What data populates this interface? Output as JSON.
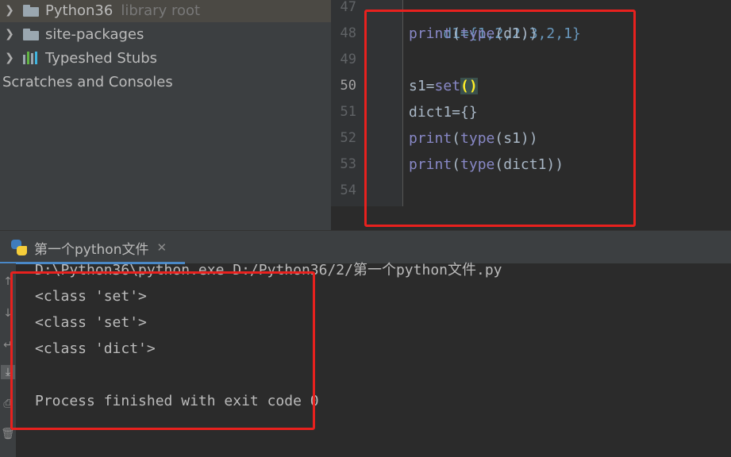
{
  "project_tree": {
    "items": [
      {
        "label": "Python36",
        "hint": "library root",
        "icon": "folder-icon"
      },
      {
        "label": "site-packages",
        "icon": "folder-icon"
      },
      {
        "label": "Typeshed Stubs",
        "icon": "stubs-icon"
      },
      {
        "label": "Scratches and Consoles"
      }
    ]
  },
  "editor": {
    "line_numbers": [
      "47",
      "48",
      "49",
      "50",
      "51",
      "52",
      "53",
      "54"
    ],
    "lines": {
      "l47": {
        "text": "d1={1,2,2,3,2,1}"
      },
      "l48": {
        "fn": "print",
        "open": "(",
        "inner_fn": "type",
        "arg": "(d1))"
      },
      "l50": {
        "lhs": "s1=",
        "fn": "set",
        "parens": "()"
      },
      "l51": {
        "text": "dict1={}"
      },
      "l52": {
        "fn": "print",
        "open": "(",
        "inner_fn": "type",
        "arg": "(s1))"
      },
      "l53": {
        "fn": "print",
        "open": "(",
        "inner_fn": "type",
        "arg": "(dict1))"
      }
    }
  },
  "run_window": {
    "tab_label": "第一个python文件",
    "console_lines": [
      "D:\\Python36\\python.exe D:/Python36/2/第一个python文件.py",
      "<class 'set'>",
      "<class 'set'>",
      "<class 'dict'>",
      "",
      "Process finished with exit code 0"
    ]
  },
  "colors": {
    "annotation": "#e8211e",
    "keyword": "#8888c6",
    "default_code": "#a9b7c6",
    "tab_underline": "#4a88c7"
  }
}
